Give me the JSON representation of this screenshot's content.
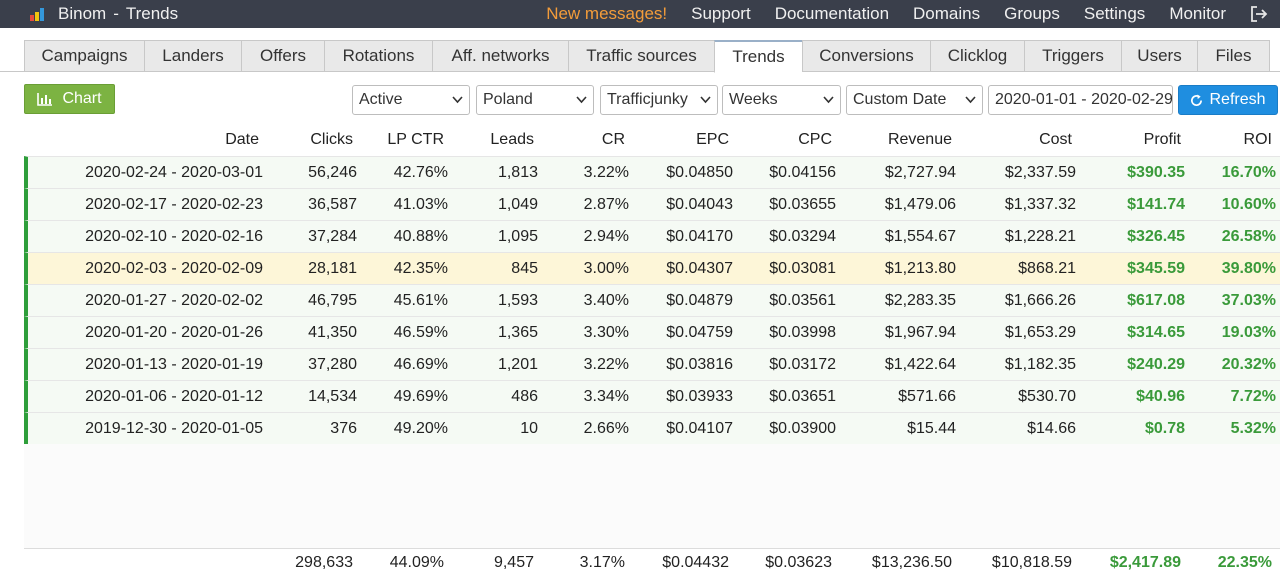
{
  "app": {
    "name": "Binom",
    "separator": "-",
    "page": "Trends"
  },
  "topnav": [
    {
      "label": "New messages!",
      "alert": true
    },
    {
      "label": "Support"
    },
    {
      "label": "Documentation"
    },
    {
      "label": "Domains"
    },
    {
      "label": "Groups"
    },
    {
      "label": "Settings"
    },
    {
      "label": "Monitor"
    }
  ],
  "tabs": [
    "Campaigns",
    "Landers",
    "Offers",
    "Rotations",
    "Aff. networks",
    "Traffic sources",
    "Trends",
    "Conversions",
    "Clicklog",
    "Triggers",
    "Users",
    "Files"
  ],
  "active_tab": "Trends",
  "toolbar": {
    "chart_label": "Chart",
    "status_select": "Active",
    "country_select": "Poland",
    "source_select": "Trafficjunky",
    "period_select": "Weeks",
    "date_mode_select": "Custom Date",
    "date_range": "2020-01-01 - 2020-02-29",
    "refresh_label": "Refresh"
  },
  "table": {
    "columns": [
      "Date",
      "Clicks",
      "LP CTR",
      "Leads",
      "CR",
      "EPC",
      "CPC",
      "Revenue",
      "Cost",
      "Profit",
      "ROI"
    ],
    "rows": [
      [
        "2020-02-24 - 2020-03-01",
        "56,246",
        "42.76%",
        "1,813",
        "3.22%",
        "$0.04850",
        "$0.04156",
        "$2,727.94",
        "$2,337.59",
        "$390.35",
        "16.70%"
      ],
      [
        "2020-02-17 - 2020-02-23",
        "36,587",
        "41.03%",
        "1,049",
        "2.87%",
        "$0.04043",
        "$0.03655",
        "$1,479.06",
        "$1,337.32",
        "$141.74",
        "10.60%"
      ],
      [
        "2020-02-10 - 2020-02-16",
        "37,284",
        "40.88%",
        "1,095",
        "2.94%",
        "$0.04170",
        "$0.03294",
        "$1,554.67",
        "$1,228.21",
        "$326.45",
        "26.58%"
      ],
      [
        "2020-02-03 - 2020-02-09",
        "28,181",
        "42.35%",
        "845",
        "3.00%",
        "$0.04307",
        "$0.03081",
        "$1,213.80",
        "$868.21",
        "$345.59",
        "39.80%"
      ],
      [
        "2020-01-27 - 2020-02-02",
        "46,795",
        "45.61%",
        "1,593",
        "3.40%",
        "$0.04879",
        "$0.03561",
        "$2,283.35",
        "$1,666.26",
        "$617.08",
        "37.03%"
      ],
      [
        "2020-01-20 - 2020-01-26",
        "41,350",
        "46.59%",
        "1,365",
        "3.30%",
        "$0.04759",
        "$0.03998",
        "$1,967.94",
        "$1,653.29",
        "$314.65",
        "19.03%"
      ],
      [
        "2020-01-13 - 2020-01-19",
        "37,280",
        "46.69%",
        "1,201",
        "3.22%",
        "$0.03816",
        "$0.03172",
        "$1,422.64",
        "$1,182.35",
        "$240.29",
        "20.32%"
      ],
      [
        "2020-01-06 - 2020-01-12",
        "14,534",
        "49.69%",
        "486",
        "3.34%",
        "$0.03933",
        "$0.03651",
        "$571.66",
        "$530.70",
        "$40.96",
        "7.72%"
      ],
      [
        "2019-12-30 - 2020-01-05",
        "376",
        "49.20%",
        "10",
        "2.66%",
        "$0.04107",
        "$0.03900",
        "$15.44",
        "$14.66",
        "$0.78",
        "5.32%"
      ]
    ],
    "highlighted_row": 3,
    "totals": [
      "",
      "298,633",
      "44.09%",
      "9,457",
      "3.17%",
      "$0.04432",
      "$0.03623",
      "$13,236.50",
      "$10,818.59",
      "$2,417.89",
      "22.35%"
    ]
  },
  "colors": {
    "topbar": "#3a3f4b",
    "alert": "#f39c3a",
    "chart_button": "#7cb342",
    "refresh_button": "#1f8ee0",
    "profit": "#3a9a3a",
    "row_marker": "#2e9e3a",
    "highlight_row": "#fdf6d8"
  }
}
